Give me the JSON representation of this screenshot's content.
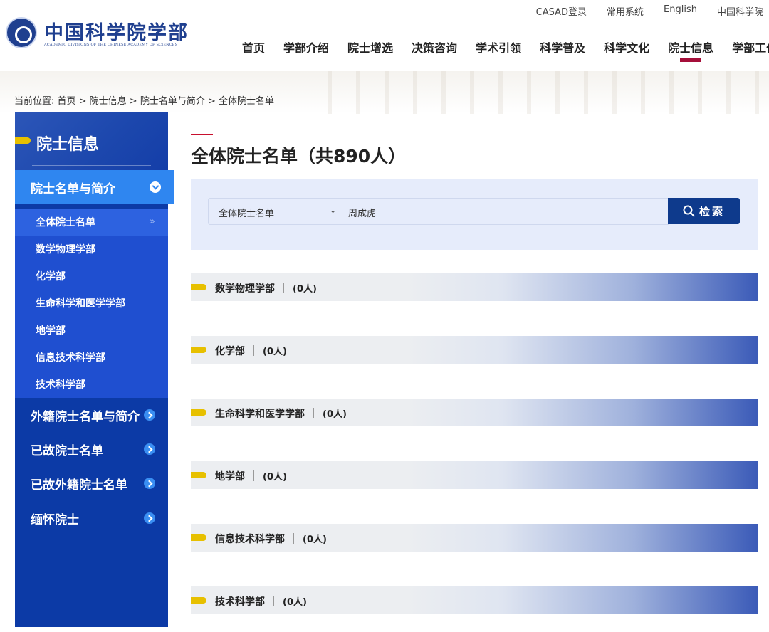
{
  "logo": {
    "cn": "中国科学院学部",
    "en": "ACADEMIC DIVISIONS OF THE CHINESE ACADEMY OF SCIENCES"
  },
  "topbar": [
    "CASAD登录",
    "常用系统",
    "English",
    "中国科学院"
  ],
  "nav": [
    "首页",
    "学部介绍",
    "院士增选",
    "决策咨询",
    "学术引领",
    "科学普及",
    "科学文化",
    "院士信息",
    "学部工作"
  ],
  "nav_active_index": 7,
  "breadcrumb": "当前位置:  首页 > 院士信息 > 院士名单与简介 > 全体院士名单",
  "sidebar": {
    "title": "院士信息",
    "active_category": "院士名单与简介",
    "sub_items": [
      "全体院士名单",
      "数学物理学部",
      "化学部",
      "生命科学和医学学部",
      "地学部",
      "信息技术科学部",
      "技术科学部"
    ],
    "sub_double_chevron": "»",
    "categories": [
      "外籍院士名单与简介",
      "已故院士名单",
      "已故外籍院士名单",
      "缅怀院士"
    ]
  },
  "main": {
    "title": "全体院士名单（共890人）",
    "search": {
      "select_value": "全体院士名单",
      "select_chevron": "⌄",
      "query": "周成虎",
      "button_label": "检索"
    },
    "departments": [
      {
        "name": "数学物理学部",
        "count": "(0人)"
      },
      {
        "name": "化学部",
        "count": "(0人)"
      },
      {
        "name": "生命科学和医学学部",
        "count": "(0人)"
      },
      {
        "name": "地学部",
        "count": "(0人)"
      },
      {
        "name": "信息技术科学部",
        "count": "(0人)"
      },
      {
        "name": "技术科学部",
        "count": "(0人)"
      }
    ]
  },
  "colors": {
    "brand_blue": "#0e3a8c",
    "sidebar_blue": "#0c3aa6",
    "sidebar_active": "#2f86f0",
    "accent_red": "#a50f3a",
    "marker_yellow": "#e7c000"
  }
}
